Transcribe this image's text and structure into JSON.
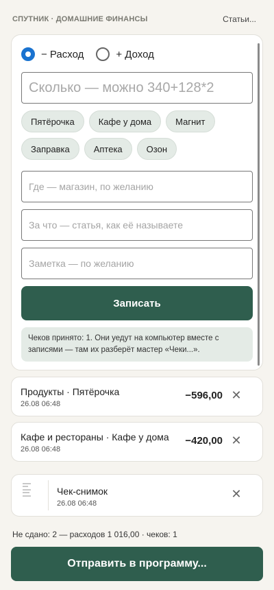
{
  "header": {
    "app_title": "СПУТНИК · ДОМАШНИЕ ФИНАНСЫ",
    "articles_link": "Статьи..."
  },
  "form": {
    "type_options": [
      {
        "label": "− Расход",
        "checked": true
      },
      {
        "label": "+ Доход",
        "checked": false
      }
    ],
    "amount_placeholder": "Сколько — можно 340+128*2",
    "amount_value": "",
    "quick_stores": [
      "Пятёрочка",
      "Кафе у дома",
      "Магнит",
      "Заправка",
      "Аптека",
      "Озон"
    ],
    "where_placeholder": "Где — магазин, по желанию",
    "what_placeholder": "За что — статья, как её называете",
    "note_placeholder": "Заметка — по желанию",
    "save_label": "Записать",
    "receipt_info": "Чеков принято: 1. Они уедут на компьютер вместе с записями — там их разберёт мастер «Чеки...»."
  },
  "entries": [
    {
      "title": "Продукты · Пятёрочка",
      "date": "26.08 06:48",
      "amount": "−596,00",
      "icon": "close-icon"
    },
    {
      "title": "Кафе и рестораны · Кафе у дома",
      "date": "26.08 06:48",
      "amount": "−420,00",
      "icon": "close-icon"
    },
    {
      "title": "Чек-снимок",
      "date": "26.08 06:48",
      "icon": "receipt-thumbnail"
    }
  ],
  "footer": {
    "summary": "Не сдано: 2 — расходов 1 016,00 · чеков: 1",
    "send_label": "Отправить в программу..."
  },
  "colors": {
    "accent_green": "#2f5e4e",
    "chip_bg": "#e4ebe6",
    "radio_blue": "#1a73d0",
    "page_bg": "#f6f4ef"
  }
}
